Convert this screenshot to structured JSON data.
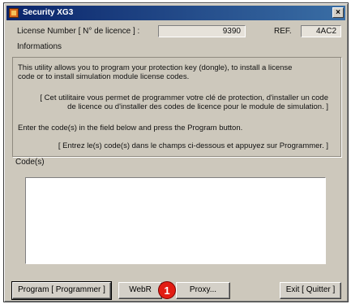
{
  "window": {
    "title": "Security XG3",
    "close_glyph": "×",
    "icon": "app-key-icon"
  },
  "license": {
    "label": "License Number [ N° de licence ] :",
    "value": "9390",
    "ref_label": "REF.",
    "ref_value": "4AC2"
  },
  "info": {
    "group_label": "Informations",
    "line1a": "This utility allows you to program your protection key (dongle), to install a license",
    "line1b": "code or to install simulation module license codes.",
    "line2a": "[ Cet utilitaire vous permet de programmer votre clé de protection, d'installer un code",
    "line2b": "de licence ou d'installer des codes de licence pour le module de simulation. ]",
    "line3": "Enter the code(s) in the field below and press the Program button.",
    "line4": "[ Entrez le(s) code(s) dans le champs ci-dessous et appuyez sur Programmer. ]"
  },
  "codes": {
    "label": "Code(s)",
    "value": ""
  },
  "buttons": {
    "program": "Program [ Programmer ]",
    "webr": "WebR",
    "proxy": "Proxy...",
    "exit": "Exit [ Quitter ]"
  },
  "annotation": {
    "badge": "1"
  },
  "colors": {
    "title_bar": "#0a246a",
    "dialog_bg": "#cdc8bc",
    "badge": "#e21d13"
  }
}
